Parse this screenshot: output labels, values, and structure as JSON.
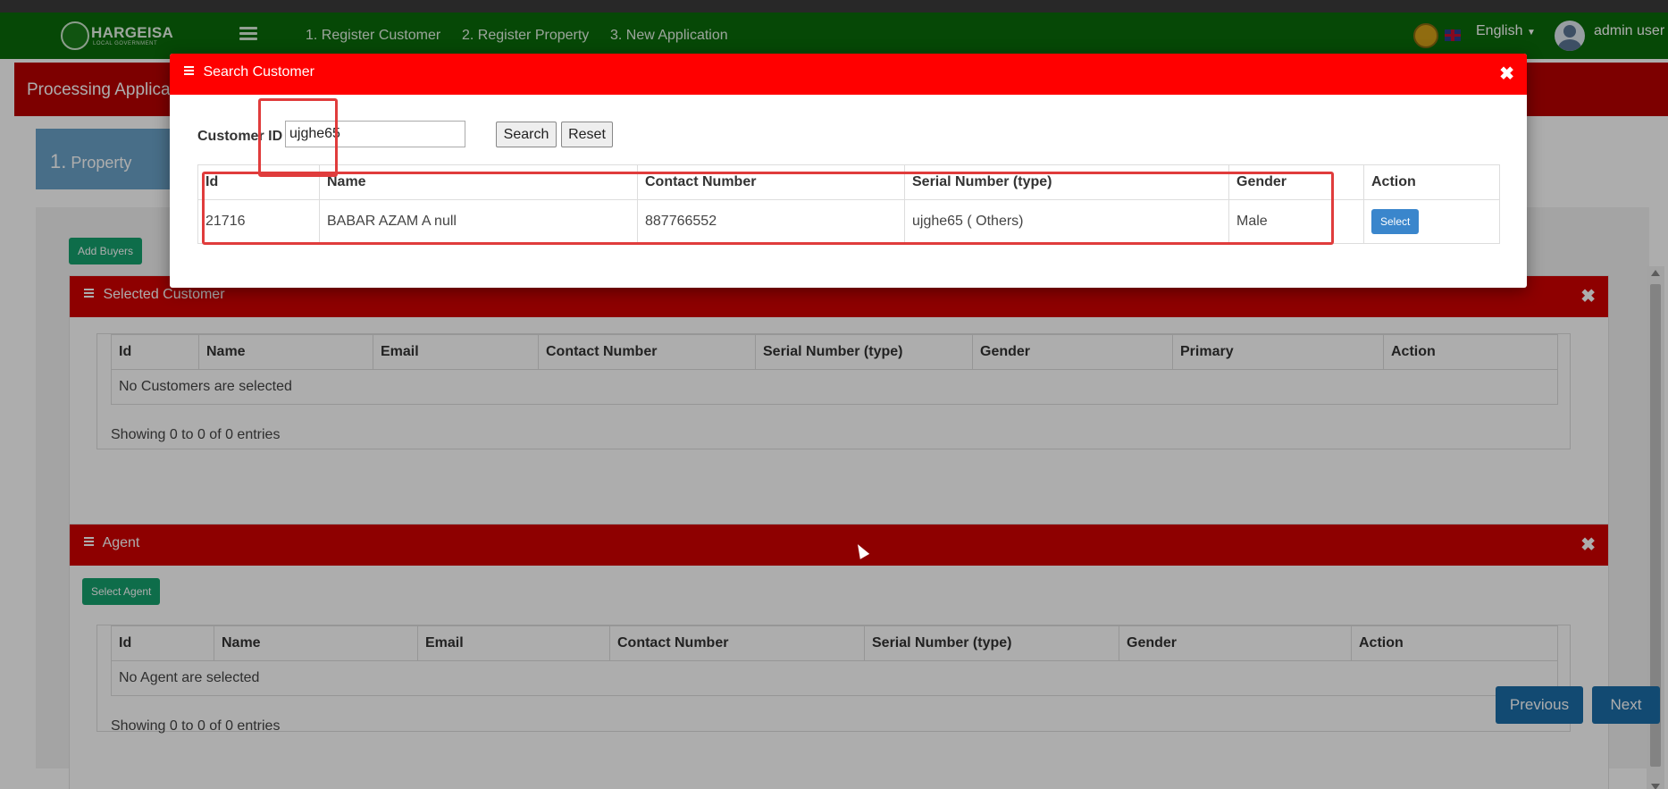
{
  "navbar": {
    "logo_text": "HARGEISA",
    "logo_sub": "LOCAL GOVERNMENT",
    "links": [
      "1. Register Customer",
      "2. Register Property",
      "3. New Application"
    ],
    "language": "English",
    "user": "admin user"
  },
  "page": {
    "header": "Processing Applicat",
    "step": {
      "number": "1.",
      "label": "Property"
    },
    "add_buyers_label": "Add Buyers",
    "selected_customer": {
      "title": "Selected Customer",
      "columns": [
        "Id",
        "Name",
        "Email",
        "Contact Number",
        "Serial Number (type)",
        "Gender",
        "Primary",
        "Action"
      ],
      "empty_text": "No Customers are selected",
      "showing": "Showing 0 to 0 of 0 entries"
    },
    "agent": {
      "title": "Agent",
      "select_label": "Select Agent",
      "columns": [
        "Id",
        "Name",
        "Email",
        "Contact Number",
        "Serial Number (type)",
        "Gender",
        "Action"
      ],
      "empty_text": "No Agent are selected",
      "showing": "Showing 0 to 0 of 0 entries"
    },
    "previous_label": "Previous",
    "next_label": "Next"
  },
  "modal": {
    "title": "Search Customer",
    "close_glyph": "✖",
    "customer_id_label": "Customer ID",
    "customer_id_value": "ujghe65",
    "search_label": "Search",
    "reset_label": "Reset",
    "columns": [
      "Id",
      "Name",
      "Contact Number",
      "Serial Number (type)",
      "Gender",
      "Action"
    ],
    "rows": [
      {
        "id": "21716",
        "name": "BABAR AZAM A null",
        "contact": "887766552",
        "serial": "ujghe65 ( Others)",
        "gender": "Male",
        "action": "Select"
      }
    ]
  },
  "colors": {
    "navbar": "#0a6b0a",
    "modal_header": "#ff0000",
    "panel_header": "#d10000",
    "highlight": "#e03c3c"
  }
}
